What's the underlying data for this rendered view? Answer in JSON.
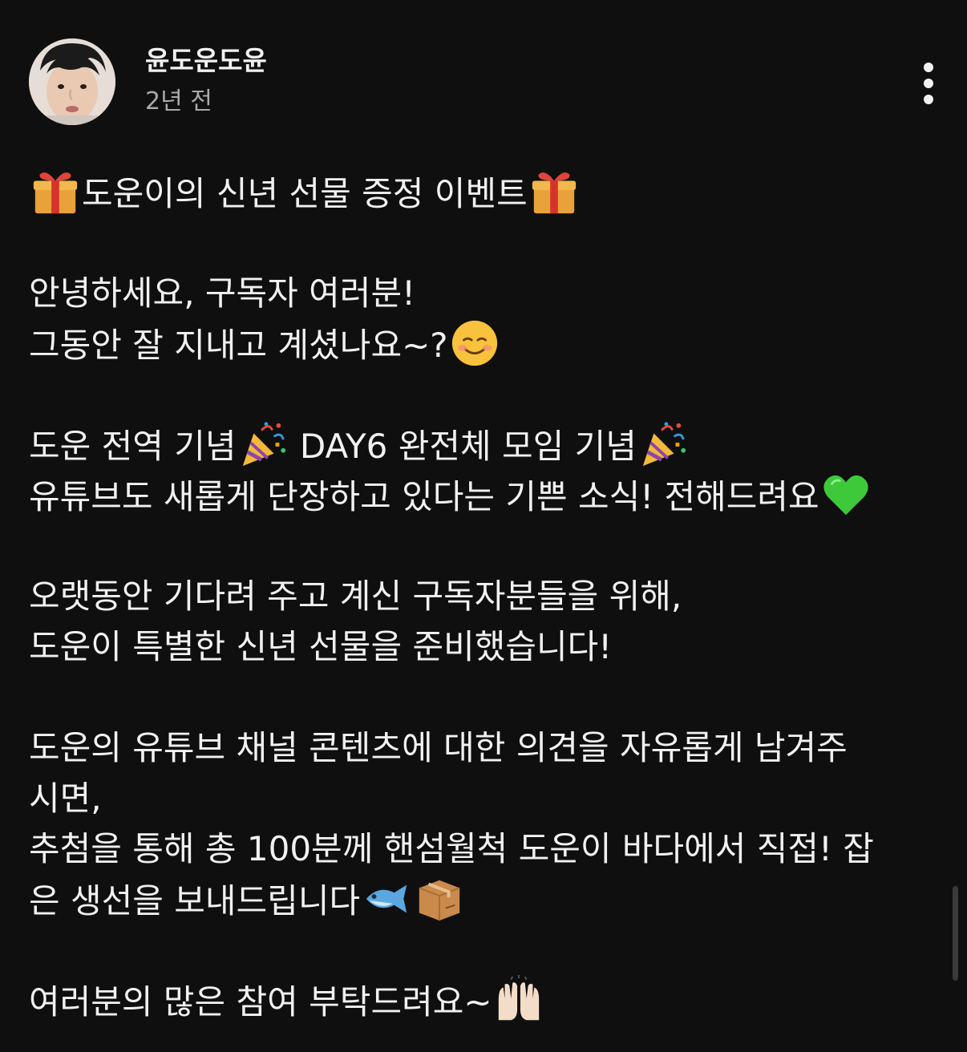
{
  "post": {
    "author": "윤도운도윤",
    "time": "2년 전",
    "menu_icon": "more-vert-icon"
  },
  "body": {
    "l1": "도운이의 신년 선물 증정 이벤트",
    "l2": "안녕하세요, 구독자 여러분!",
    "l3": "그동안 잘 지내고 계셨나요~?",
    "l4a": "도운 전역 기념",
    "l4b": " DAY6 완전체 모임 기념",
    "l5": "유튜브도 새롭게 단장하고 있다는 기쁜 소식! 전해드려요",
    "l6": "오랫동안 기다려 주고 계신 구독자분들을 위해,",
    "l7": "도운이 특별한 신년 선물을 준비했습니다!",
    "l8": "도운의 유튜브 채널 콘텐츠에 대한 의견을 자유롭게 남겨주",
    "l9": "시면,",
    "l10": "추첨을 통해 총 100분께 핸섬월척 도운이 바다에서 직접! 잡",
    "l11": "은 생선을 보내드립니다",
    "l12": "여러분의 많은 참여 부탁드려요~"
  },
  "emoji": {
    "gift": "gift-emoji",
    "smile": "smiling-face-emoji",
    "party": "party-popper-emoji",
    "heart": "green-heart-emoji",
    "fish": "fish-emoji",
    "box": "package-emoji",
    "hands": "raising-hands-emoji"
  }
}
